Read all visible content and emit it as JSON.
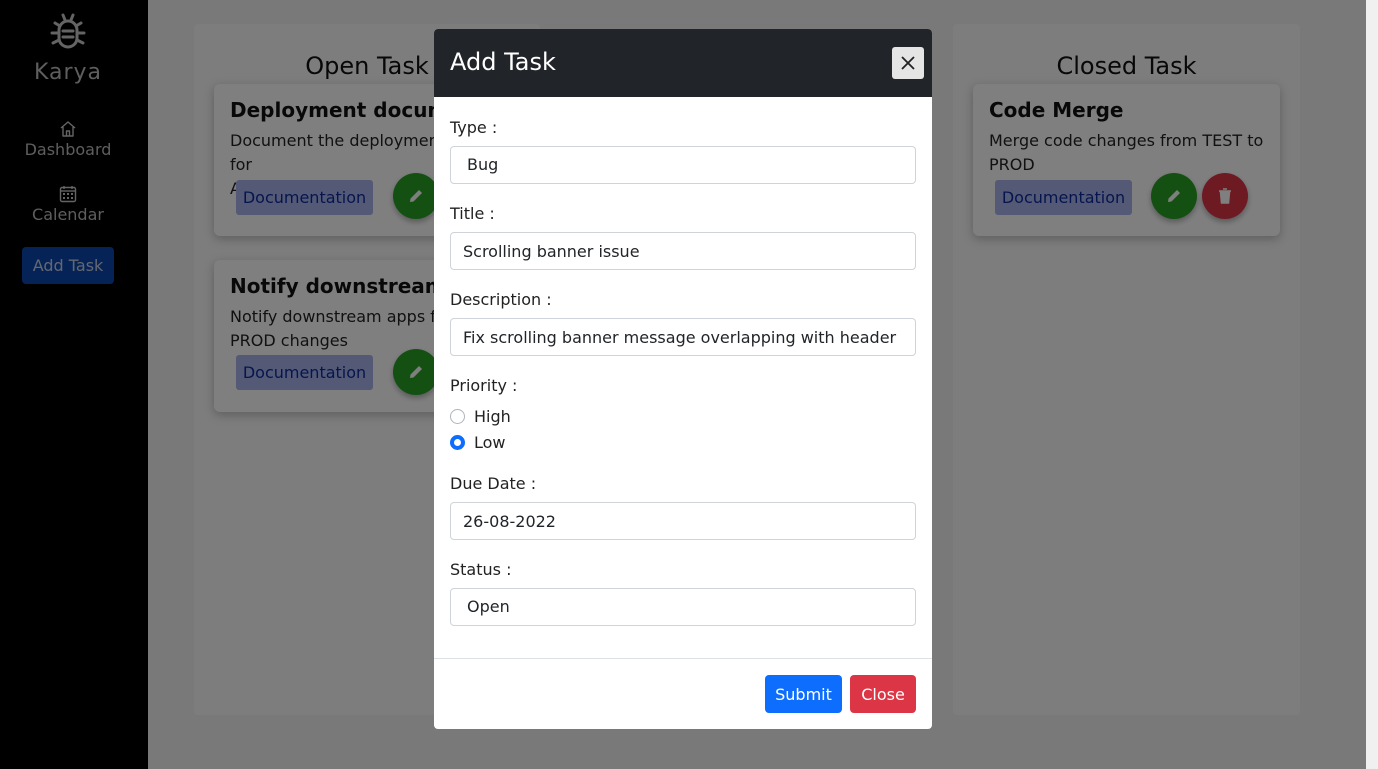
{
  "sidebar": {
    "brand": "Karya",
    "items": [
      {
        "label": "Dashboard",
        "icon": "home-icon"
      },
      {
        "label": "Calendar",
        "icon": "calendar-icon"
      }
    ],
    "add_task_label": "Add Task"
  },
  "board": {
    "columns": [
      {
        "title": "Open Task",
        "cards": [
          {
            "title": "Deployment document",
            "description_lines": [
              "Document the deployment steps for",
              "Azure"
            ],
            "tag": "Documentation"
          },
          {
            "title": "Notify downstream",
            "description_lines": [
              "Notify downstream apps for",
              "PROD changes"
            ],
            "tag": "Documentation"
          }
        ]
      },
      {
        "title": "Closed Task",
        "cards": [
          {
            "title": "Code Merge",
            "description_lines": [
              "Merge code changes from TEST to",
              "PROD"
            ],
            "tag": "Documentation"
          }
        ]
      }
    ]
  },
  "modal": {
    "title": "Add Task",
    "fields": {
      "type": {
        "label": "Type :",
        "value": "Bug"
      },
      "title": {
        "label": "Title :",
        "value": "Scrolling banner issue"
      },
      "description": {
        "label": "Description :",
        "value": "Fix scrolling banner message overlapping with header"
      },
      "priority": {
        "label": "Priority :",
        "options": [
          "High",
          "Low"
        ],
        "selected": "Low"
      },
      "due_date": {
        "label": "Due Date :",
        "value": "26-08-2022"
      },
      "status": {
        "label": "Status :",
        "value": "Open"
      }
    },
    "submit_label": "Submit",
    "close_label": "Close"
  },
  "colors": {
    "sidebar_bg": "#000000",
    "modal_header_bg": "#212529",
    "primary": "#0d6efd",
    "danger": "#dc3545",
    "edit": "#27a125",
    "tag_bg": "#a8b4ec"
  }
}
